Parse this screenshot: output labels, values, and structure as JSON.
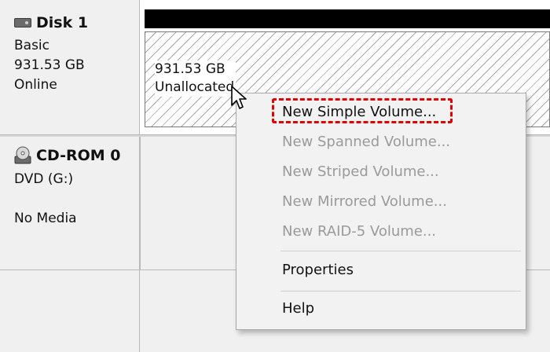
{
  "disk1": {
    "title": "Disk 1",
    "type": "Basic",
    "size": "931.53 GB",
    "status": "Online",
    "icon": "hard-disk-icon"
  },
  "cdrom": {
    "title": "CD-ROM 0",
    "drive": "DVD (G:)",
    "media": "No Media",
    "icon": "cd-rom-icon"
  },
  "volume": {
    "size": "931.53 GB",
    "state": "Unallocated",
    "header_color": "#000000"
  },
  "context_menu": {
    "items": [
      {
        "label": "New Simple Volume...",
        "enabled": true,
        "highlighted": true
      },
      {
        "label": "New Spanned Volume...",
        "enabled": false
      },
      {
        "label": "New Striped Volume...",
        "enabled": false
      },
      {
        "label": "New Mirrored Volume...",
        "enabled": false
      },
      {
        "label": "New RAID-5 Volume...",
        "enabled": false
      },
      {
        "label": "Properties",
        "enabled": true
      },
      {
        "label": "Help",
        "enabled": true
      }
    ],
    "highlight_color": "#e00000"
  }
}
